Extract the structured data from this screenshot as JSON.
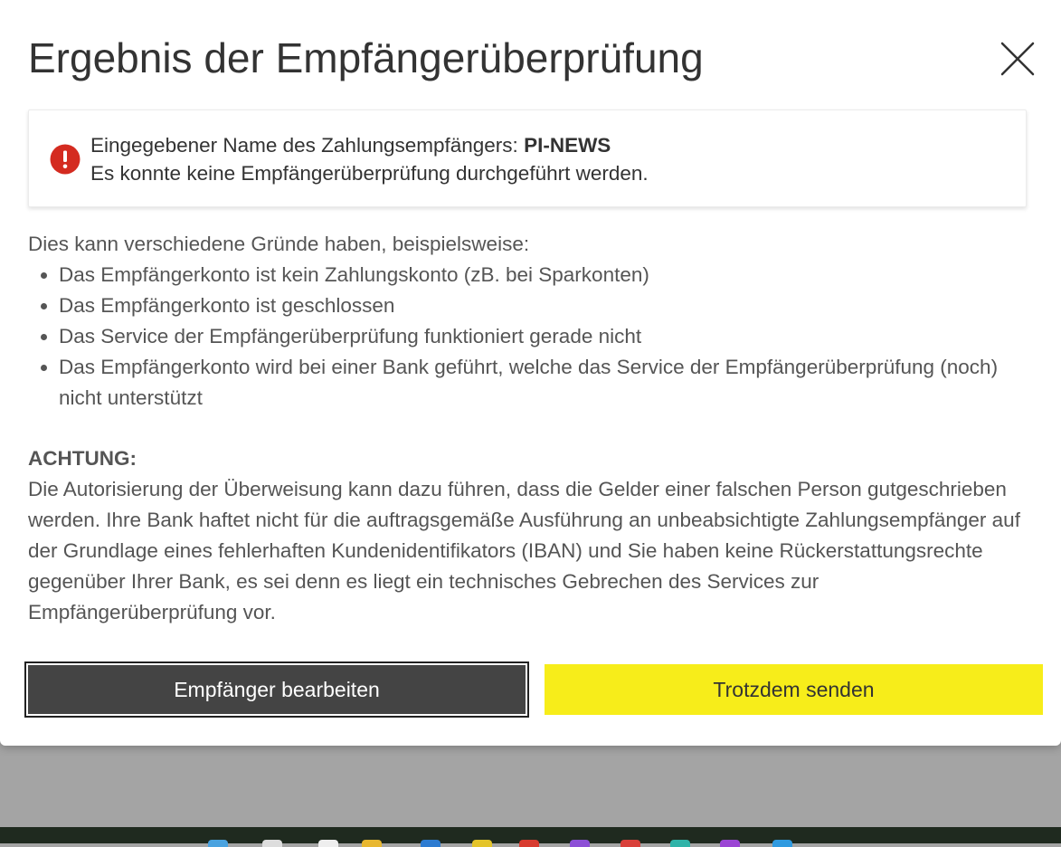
{
  "dialog": {
    "title": "Ergebnis der Empfängerüberprüfung",
    "close_icon": "close-icon"
  },
  "alert": {
    "icon": "error-icon",
    "icon_color": "#d42b20",
    "label": "Eingegebener Name des Zahlungsempfängers:",
    "payee_name": "PI-NEWS",
    "message": "Es konnte keine Empfängerüberprüfung durchgeführt werden."
  },
  "reasons": {
    "intro": "Dies kann verschiedene Gründe haben, beispielsweise:",
    "items": [
      "Das Empfängerkonto ist kein Zahlungskonto (zB. bei Sparkonten)",
      "Das Empfängerkonto ist geschlossen",
      "Das Service der Empfängerüberprüfung funktioniert gerade nicht",
      "Das Empfängerkonto wird bei einer Bank geführt, welche das Service der Empfängerüberprüfung (noch) nicht unterstützt"
    ]
  },
  "warning": {
    "heading": "ACHTUNG:",
    "body": "Die Autorisierung der Überweisung kann dazu führen, dass die Gelder einer falschen Person gutgeschrieben werden. Ihre Bank haftet nicht für die auftragsgemäße Ausführung an unbeabsichtigte Zahlungsempfänger auf der Grundlage eines fehlerhaften Kundenidentifikators (IBAN) und Sie haben keine Rückerstattungsrechte gegenüber Ihrer Bank, es sei denn es liegt ein technisches Gebrechen des Services zur Empfängerüberprüfung vor."
  },
  "actions": {
    "edit_label": "Empfänger bearbeiten",
    "send_label": "Trotzdem senden",
    "edit_color": "#444444",
    "send_color": "#f7ed1a"
  }
}
